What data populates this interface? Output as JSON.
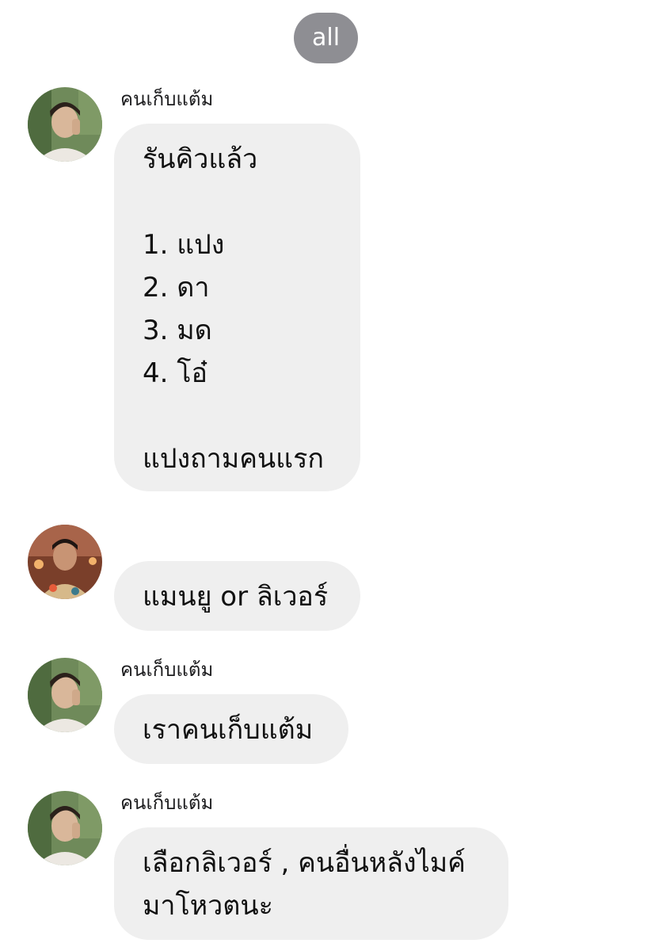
{
  "filter_chip": {
    "label": "all"
  },
  "messages": [
    {
      "sender": "คนเก็บแต้ม",
      "avatar": "avatar-photo-1",
      "lines": [
        "รันคิวแล้ว",
        "",
        "1. แปง",
        "2. ดา",
        "3. มด",
        "4. โอ๋",
        "",
        "แปงถามคนแรก"
      ]
    },
    {
      "sender": "",
      "avatar": "avatar-photo-2",
      "lines": [
        "แมนยู or ลิเวอร์"
      ]
    },
    {
      "sender": "คนเก็บแต้ม",
      "avatar": "avatar-photo-1",
      "lines": [
        "เราคนเก็บแต้ม"
      ]
    },
    {
      "sender": "คนเก็บแต้ม",
      "avatar": "avatar-photo-1",
      "lines": [
        "เลือกลิเวอร์ , คนอื่นหลังไมค์",
        "มาโหวตนะ"
      ]
    }
  ]
}
